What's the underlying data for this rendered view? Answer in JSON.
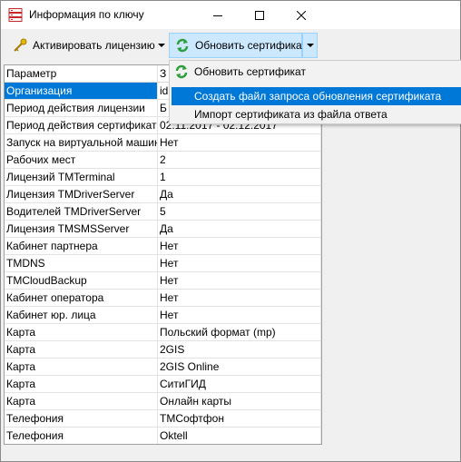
{
  "window": {
    "title": "Информация по ключу",
    "app_icon": "key-info-app-icon",
    "controls": {
      "minimize": "minimize-icon",
      "maximize": "maximize-icon",
      "close": "close-icon"
    }
  },
  "toolbar": {
    "activate_label": "Активировать лицензию",
    "activate_icon": "key-icon",
    "update_label": "Обновить сертификат",
    "update_icon": "refresh-icon",
    "dropdown_icon": "chevron-down-icon"
  },
  "grid": {
    "columns": [
      "Параметр",
      "З"
    ],
    "rows": [
      {
        "param": "Организация",
        "value": "id"
      },
      {
        "param": "Период действия лицензии",
        "value": "Б"
      },
      {
        "param": "Период действия сертификата",
        "value": "02.11.2017 - 02.12.2017"
      },
      {
        "param": "Запуск на виртуальной машине",
        "value": "Нет"
      },
      {
        "param": "Рабочих мест",
        "value": "2"
      },
      {
        "param": "Лицензий TMTerminal",
        "value": "1"
      },
      {
        "param": "Лицензия TMDriverServer",
        "value": "Да"
      },
      {
        "param": "Водителей TMDriverServer",
        "value": "5"
      },
      {
        "param": "Лицензия TMSMSServer",
        "value": "Да"
      },
      {
        "param": "Кабинет партнера",
        "value": "Нет"
      },
      {
        "param": "TMDNS",
        "value": "Нет"
      },
      {
        "param": "TMCloudBackup",
        "value": "Нет"
      },
      {
        "param": "Кабинет оператора",
        "value": "Нет"
      },
      {
        "param": "Кабинет юр. лица",
        "value": "Нет"
      },
      {
        "param": "Карта",
        "value": "Польский формат (mp)"
      },
      {
        "param": "Карта",
        "value": "2GIS"
      },
      {
        "param": "Карта",
        "value": "2GIS Online"
      },
      {
        "param": "Карта",
        "value": "СитиГИД"
      },
      {
        "param": "Карта",
        "value": "Онлайн карты"
      },
      {
        "param": "Телефония",
        "value": "ТМСофтфон"
      },
      {
        "param": "Телефония",
        "value": "Oktell"
      }
    ]
  },
  "menu": {
    "items": [
      {
        "label": "Обновить сертификат",
        "icon": "refresh-icon"
      },
      {
        "label": "Создать файл запроса обновления сертификата"
      },
      {
        "label": "Импорт сертификата из файла ответа"
      }
    ]
  },
  "colors": {
    "selection": "#0078d7",
    "hover_button": "#cce8ff",
    "refresh_green": "#2e9e3e"
  }
}
